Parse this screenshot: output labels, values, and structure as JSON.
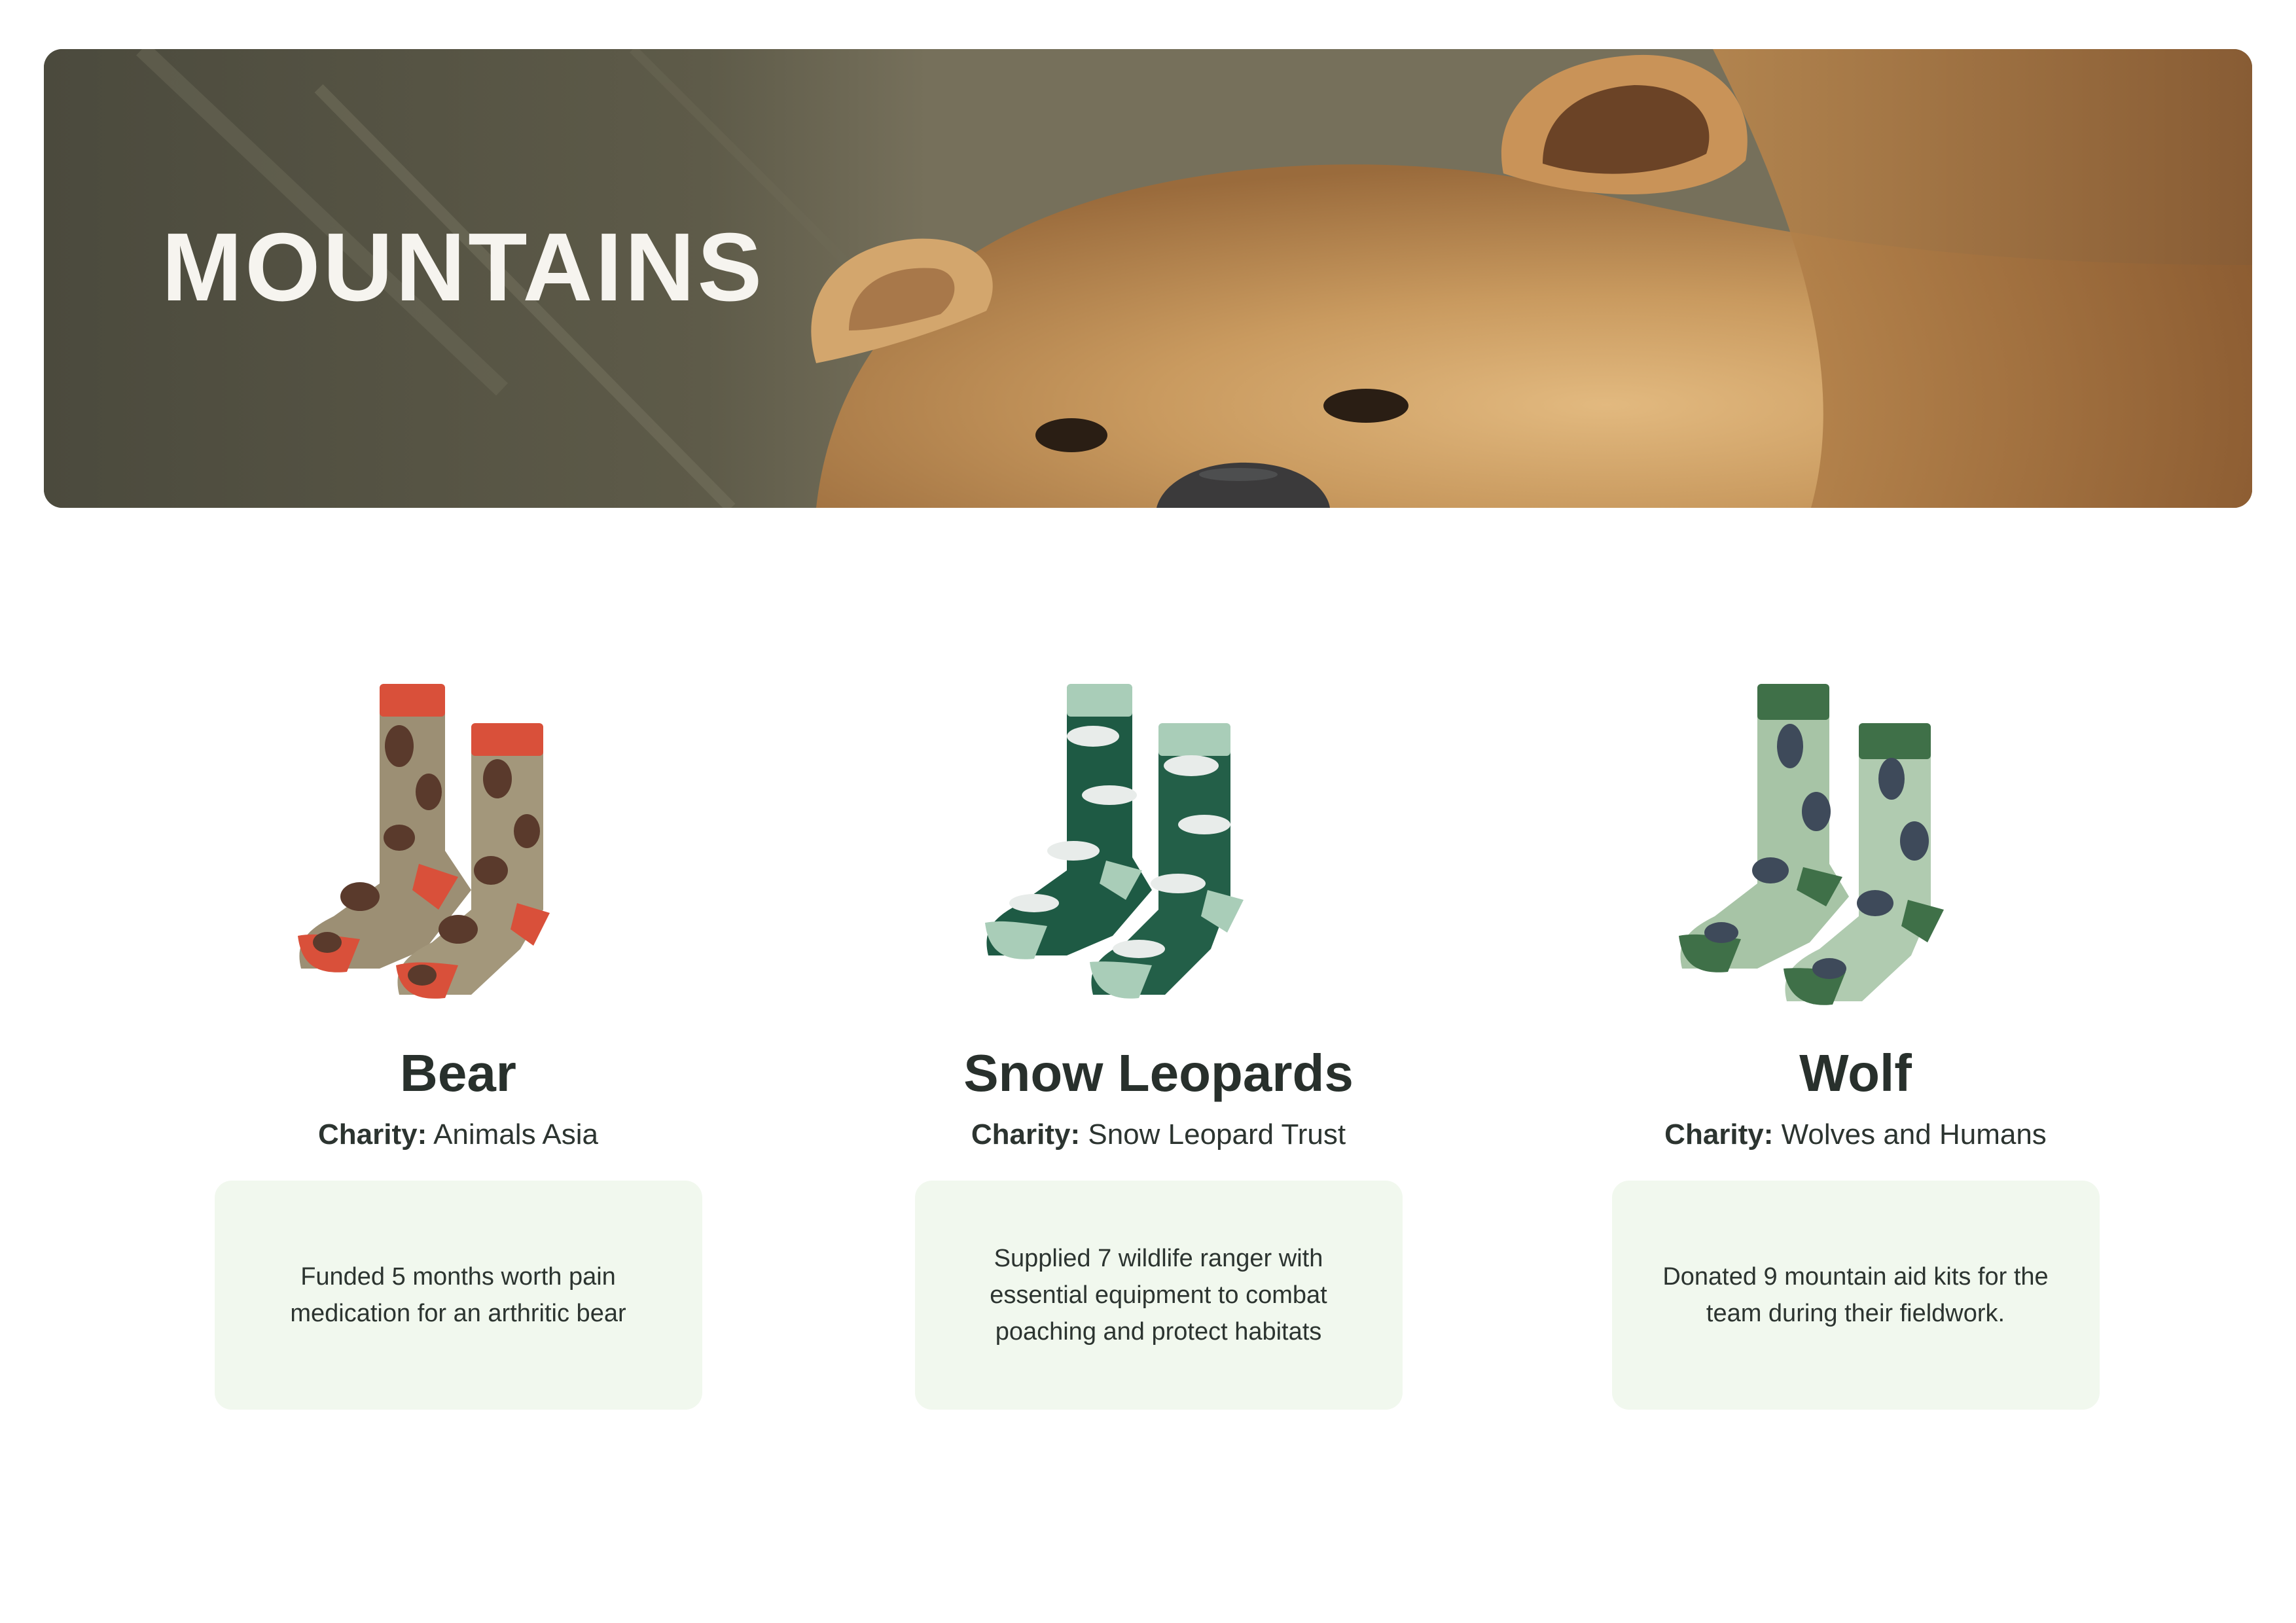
{
  "banner": {
    "title": "MOUNTAINS",
    "image": "brown-bear-photo"
  },
  "products": [
    {
      "name": "Bear",
      "charity_label": "Charity:",
      "charity": "Animals Asia",
      "impact": "Funded 5 months worth pain medication for an arthritic bear",
      "colors": {
        "body": "#9c8f74",
        "accent": "#d9503a",
        "motif": "#5a3a2c"
      }
    },
    {
      "name": "Snow Leopards",
      "charity_label": "Charity:",
      "charity": "Snow Leopard Trust",
      "impact": "Supplied 7 wildlife ranger with essential equipment to combat poaching and protect habitats",
      "colors": {
        "body": "#1e5a44",
        "accent": "#a9cdb8",
        "motif": "#e8ecea"
      }
    },
    {
      "name": "Wolf",
      "charity_label": "Charity:",
      "charity": "Wolves and Humans",
      "impact": "Donated 9 mountain aid kits for the team during their fieldwork.",
      "colors": {
        "body": "#a7c4a6",
        "accent": "#3f7048",
        "motif": "#3e4a5a"
      }
    }
  ]
}
